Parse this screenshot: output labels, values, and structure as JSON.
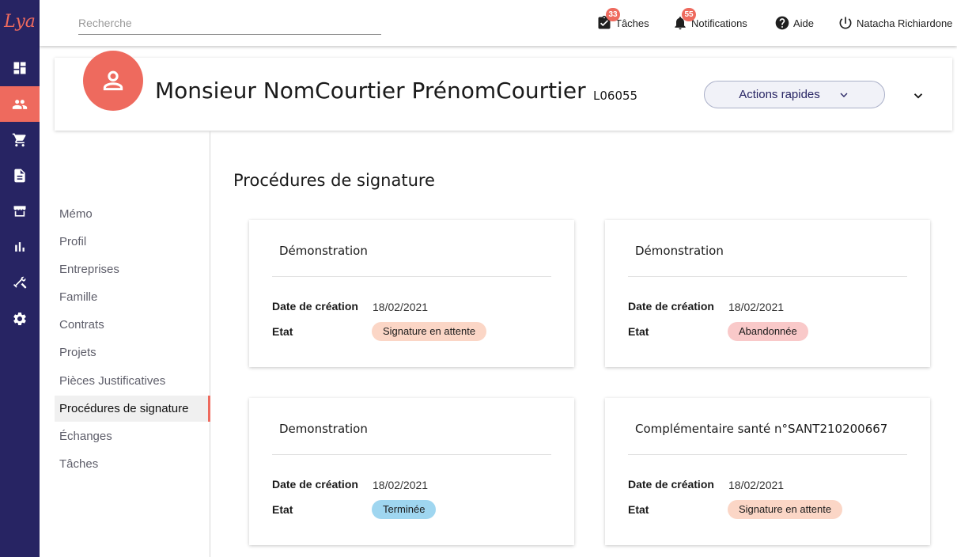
{
  "app": {
    "logo": "Lya"
  },
  "rail": {
    "items": [
      {
        "name": "dashboard-icon",
        "active": false
      },
      {
        "name": "people-icon",
        "active": true
      },
      {
        "name": "cart-icon",
        "active": false
      },
      {
        "name": "document-icon",
        "active": false
      },
      {
        "name": "store-icon",
        "active": false
      },
      {
        "name": "bar-chart-icon",
        "active": false
      },
      {
        "name": "tools-icon",
        "active": false
      },
      {
        "name": "gear-icon",
        "active": false
      }
    ]
  },
  "topbar": {
    "search_placeholder": "Recherche",
    "tasks": {
      "label": "Tâches",
      "count": "33"
    },
    "notifications": {
      "label": "Notifications",
      "count": "55"
    },
    "help": {
      "label": "Aide"
    },
    "user": {
      "label": "Natacha Richiardone"
    }
  },
  "header": {
    "name": "Monsieur NomCourtier PrénomCourtier",
    "code": "L06055",
    "quick_actions": "Actions rapides"
  },
  "nav": {
    "items": [
      {
        "label": "Mémo",
        "active": false
      },
      {
        "label": "Profil",
        "active": false
      },
      {
        "label": "Entreprises",
        "active": false
      },
      {
        "label": "Famille",
        "active": false
      },
      {
        "label": "Contrats",
        "active": false
      },
      {
        "label": "Projets",
        "active": false
      },
      {
        "label": "Pièces Justificatives",
        "active": false
      },
      {
        "label": "Procédures de signature",
        "active": true
      },
      {
        "label": "Échanges",
        "active": false
      },
      {
        "label": "Tâches",
        "active": false
      }
    ]
  },
  "main": {
    "title": "Procédures de signature",
    "date_label": "Date de création",
    "state_label": "Etat",
    "cards": [
      {
        "title": "Démonstration",
        "date": "18/02/2021",
        "status": "Signature en attente",
        "status_color": "#fbd6c6"
      },
      {
        "title": "Démonstration",
        "date": "18/02/2021",
        "status": "Abandonnée",
        "status_color": "#f9c9c9"
      },
      {
        "title": "Demonstration",
        "date": "18/02/2021",
        "status": "Terminée",
        "status_color": "#9fd6f0"
      },
      {
        "title": "Complémentaire santé n°SANT210200667",
        "date": "18/02/2021",
        "status": "Signature en attente",
        "status_color": "#fbd6c6"
      }
    ]
  },
  "colors": {
    "rail": "#272463",
    "accent": "#ee6a5e"
  }
}
